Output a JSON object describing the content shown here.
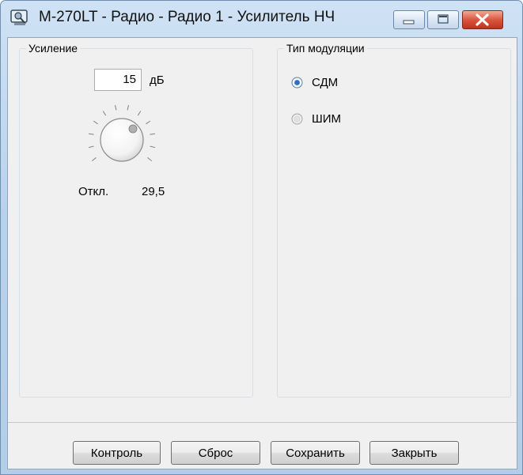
{
  "window": {
    "title": "M-270LT - Радио - Радио 1 - Усилитель НЧ",
    "icon": "app-icon"
  },
  "gain_group": {
    "label": "Усиление",
    "value": "15",
    "unit": "дБ",
    "knob_min_label": "Откл.",
    "knob_max_label": "29,5"
  },
  "modulation_group": {
    "label": "Тип модуляции",
    "options": [
      {
        "label": "СДМ",
        "selected": true
      },
      {
        "label": "ШИМ",
        "selected": false
      }
    ]
  },
  "footer": {
    "control_label": "Контроль",
    "reset_label": "Сброс",
    "save_label": "Сохранить",
    "close_label": "Закрыть"
  },
  "colors": {
    "titlebar": "#c2d8ef",
    "close_button": "#d44a33",
    "radio_selected": "#2e6fc1"
  }
}
